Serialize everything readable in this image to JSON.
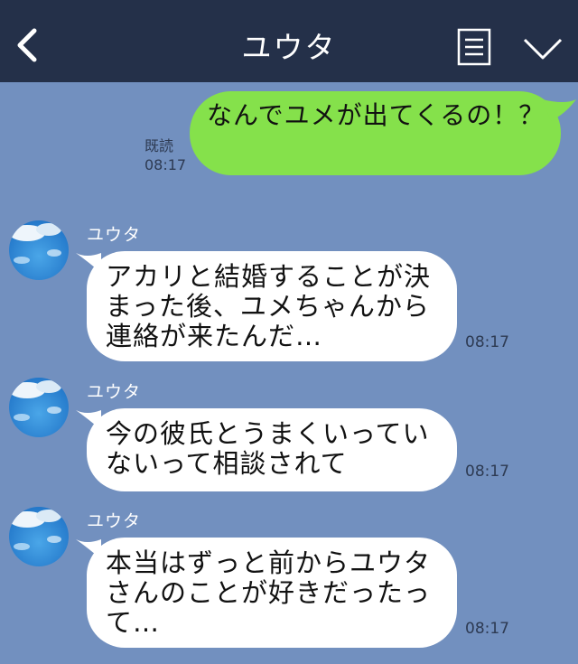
{
  "header": {
    "title": "ユウタ",
    "icons": [
      "back-icon",
      "menu-icon",
      "chevron-down-icon"
    ]
  },
  "messages": [
    {
      "direction": "outgoing",
      "text": "なんでユメが出てくるの！？",
      "read_label": "既読",
      "time": "08:17"
    },
    {
      "direction": "incoming",
      "sender": "ユウタ",
      "text": "アカリと結婚することが決まった後、ユメちゃんから連絡が来たんだ…",
      "time": "08:17"
    },
    {
      "direction": "incoming",
      "sender": "ユウタ",
      "text": "今の彼氏とうまくいっていないって相談されて",
      "time": "08:17"
    },
    {
      "direction": "incoming",
      "sender": "ユウタ",
      "text": "本当はずっと前からユウタさんのことが好きだったって…",
      "time": "08:17"
    }
  ],
  "colors": {
    "header_bg": "#243049",
    "chat_bg": "#7290bf",
    "outgoing_bubble": "#85e14b",
    "incoming_bubble": "#ffffff"
  }
}
